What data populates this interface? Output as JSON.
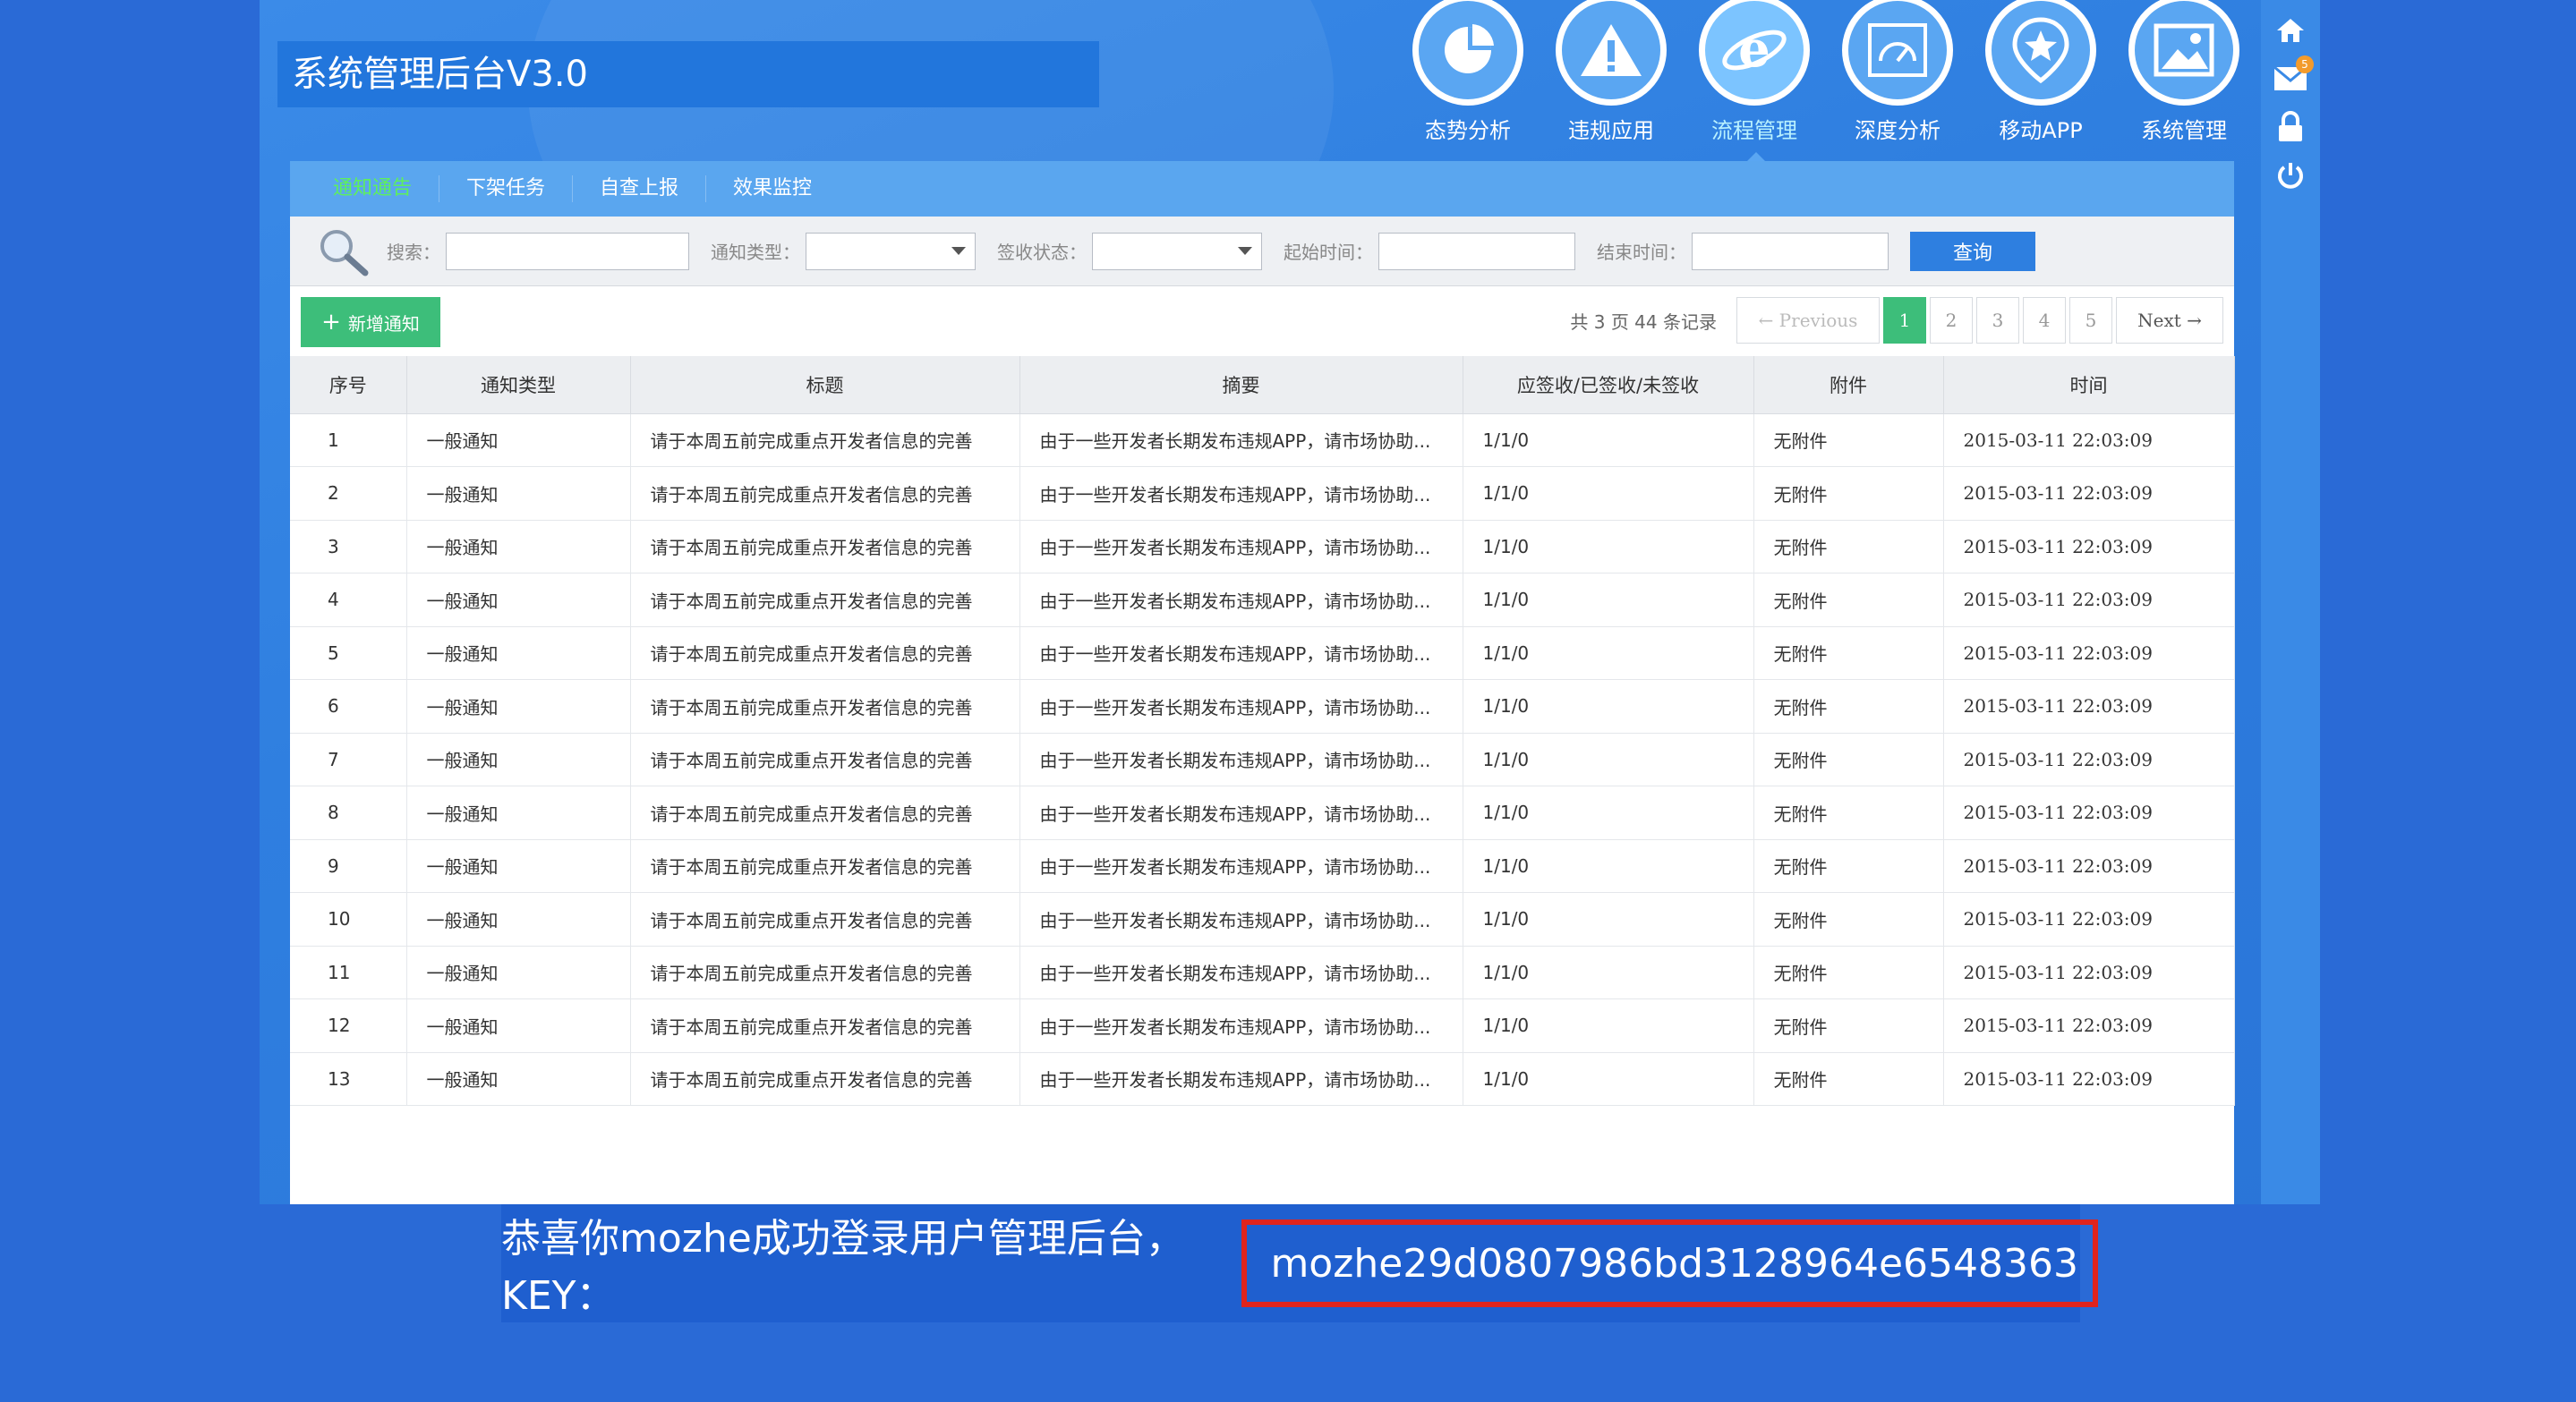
{
  "app": {
    "title": "系统管理后台V3.0"
  },
  "nav": [
    {
      "label": "态势分析",
      "icon": "pie-chart-icon",
      "active": false
    },
    {
      "label": "违规应用",
      "icon": "warning-icon",
      "active": false
    },
    {
      "label": "流程管理",
      "icon": "browser-e-icon",
      "active": true
    },
    {
      "label": "深度分析",
      "icon": "gauge-icon",
      "active": false
    },
    {
      "label": "移动APP",
      "icon": "star-badge-icon",
      "active": false
    },
    {
      "label": "系统管理",
      "icon": "image-icon",
      "active": false
    }
  ],
  "rail": {
    "mail_badge": "5",
    "icons": [
      "home-icon",
      "mail-icon",
      "lock-icon",
      "power-icon"
    ]
  },
  "tabs": [
    {
      "label": "通知通告",
      "active": true
    },
    {
      "label": "下架任务",
      "active": false
    },
    {
      "label": "自查上报",
      "active": false
    },
    {
      "label": "效果监控",
      "active": false
    }
  ],
  "search": {
    "keyword_label": "搜索：",
    "type_label": "通知类型：",
    "status_label": "签收状态：",
    "start_label": "起始时间：",
    "end_label": "结束时间：",
    "query_button": "查询"
  },
  "actions": {
    "add_button": "新增通知"
  },
  "pager": {
    "record_text": "共 3 页 44 条记录",
    "prev": "← Previous",
    "pages": [
      "1",
      "2",
      "3",
      "4",
      "5"
    ],
    "current": "1",
    "next": "Next →"
  },
  "table": {
    "columns": [
      "序号",
      "通知类型",
      "标题",
      "摘要",
      "应签收/已签收/未签收",
      "附件",
      "时间"
    ],
    "rows": [
      [
        "1",
        "一般通知",
        "请于本周五前完成重点开发者信息的完善",
        "由于一些开发者长期发布违规APP，请市场协助...",
        "1/1/0",
        "无附件",
        "2015-03-11 22:03:09"
      ],
      [
        "2",
        "一般通知",
        "请于本周五前完成重点开发者信息的完善",
        "由于一些开发者长期发布违规APP，请市场协助...",
        "1/1/0",
        "无附件",
        "2015-03-11 22:03:09"
      ],
      [
        "3",
        "一般通知",
        "请于本周五前完成重点开发者信息的完善",
        "由于一些开发者长期发布违规APP，请市场协助...",
        "1/1/0",
        "无附件",
        "2015-03-11 22:03:09"
      ],
      [
        "4",
        "一般通知",
        "请于本周五前完成重点开发者信息的完善",
        "由于一些开发者长期发布违规APP，请市场协助...",
        "1/1/0",
        "无附件",
        "2015-03-11 22:03:09"
      ],
      [
        "5",
        "一般通知",
        "请于本周五前完成重点开发者信息的完善",
        "由于一些开发者长期发布违规APP，请市场协助...",
        "1/1/0",
        "无附件",
        "2015-03-11 22:03:09"
      ],
      [
        "6",
        "一般通知",
        "请于本周五前完成重点开发者信息的完善",
        "由于一些开发者长期发布违规APP，请市场协助...",
        "1/1/0",
        "无附件",
        "2015-03-11 22:03:09"
      ],
      [
        "7",
        "一般通知",
        "请于本周五前完成重点开发者信息的完善",
        "由于一些开发者长期发布违规APP，请市场协助...",
        "1/1/0",
        "无附件",
        "2015-03-11 22:03:09"
      ],
      [
        "8",
        "一般通知",
        "请于本周五前完成重点开发者信息的完善",
        "由于一些开发者长期发布违规APP，请市场协助...",
        "1/1/0",
        "无附件",
        "2015-03-11 22:03:09"
      ],
      [
        "9",
        "一般通知",
        "请于本周五前完成重点开发者信息的完善",
        "由于一些开发者长期发布违规APP，请市场协助...",
        "1/1/0",
        "无附件",
        "2015-03-11 22:03:09"
      ],
      [
        "10",
        "一般通知",
        "请于本周五前完成重点开发者信息的完善",
        "由于一些开发者长期发布违规APP，请市场协助...",
        "1/1/0",
        "无附件",
        "2015-03-11 22:03:09"
      ],
      [
        "11",
        "一般通知",
        "请于本周五前完成重点开发者信息的完善",
        "由于一些开发者长期发布违规APP，请市场协助...",
        "1/1/0",
        "无附件",
        "2015-03-11 22:03:09"
      ],
      [
        "12",
        "一般通知",
        "请于本周五前完成重点开发者信息的完善",
        "由于一些开发者长期发布违规APP，请市场协助...",
        "1/1/0",
        "无附件",
        "2015-03-11 22:03:09"
      ],
      [
        "13",
        "一般通知",
        "请于本周五前完成重点开发者信息的完善",
        "由于一些开发者长期发布违规APP，请市场协助...",
        "1/1/0",
        "无附件",
        "2015-03-11 22:03:09"
      ]
    ]
  },
  "banner": {
    "message": "恭喜你mozhe成功登录用户管理后台，KEY：",
    "key": "mozhe29d0807986bd3128964e6548363"
  },
  "colors": {
    "page_bg": "#2a6ad6",
    "accent": "#2e7fe0",
    "green": "#3dbe7a",
    "highlight_box": "#e0241d"
  }
}
